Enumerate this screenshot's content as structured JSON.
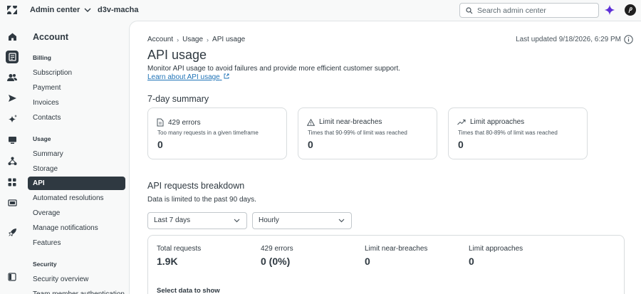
{
  "topbar": {
    "app_switcher_label": "Admin center",
    "subdomain": "d3v-macha",
    "search_placeholder": "Search admin center"
  },
  "nav": {
    "title": "Account",
    "sections": [
      {
        "label": "Billing",
        "items": [
          "Subscription",
          "Payment",
          "Invoices",
          "Contacts"
        ]
      },
      {
        "label": "Usage",
        "items": [
          "Summary",
          "Storage",
          "API",
          "Automated resolutions",
          "Overage",
          "Manage notifications",
          "Features"
        ]
      },
      {
        "label": "Security",
        "items": [
          "Security overview",
          "Team member authentication"
        ]
      }
    ],
    "active_item": "API"
  },
  "breadcrumb": [
    "Account",
    "API usage"
  ],
  "breadcrumb_usage": "Usage",
  "last_updated": "Last updated 9/18/2026, 6:29 PM",
  "page": {
    "title": "API usage",
    "description": "Monitor API usage to avoid failures and provide more efficient customer support.",
    "learn_link": "Learn about API usage"
  },
  "summary": {
    "title": "7-day summary",
    "cards": [
      {
        "icon": "document-icon",
        "title": "429 errors",
        "subtitle": "Too many requests in a given timeframe",
        "value": "0"
      },
      {
        "icon": "warning-icon",
        "title": "Limit near-breaches",
        "subtitle": "Times that 90-99% of limit was reached",
        "value": "0"
      },
      {
        "icon": "trend-up-icon",
        "title": "Limit approaches",
        "subtitle": "Times that 80-89% of limit was reached",
        "value": "0"
      }
    ]
  },
  "breakdown": {
    "title": "API requests breakdown",
    "note": "Data is limited to the past 90 days.",
    "range_select": "Last 7 days",
    "granularity_select": "Hourly",
    "stats": [
      {
        "label": "Total requests",
        "value": "1.9K"
      },
      {
        "label": "429 errors",
        "value": "0 (0%)"
      },
      {
        "label": "Limit near-breaches",
        "value": "0"
      },
      {
        "label": "Limit approaches",
        "value": "0"
      }
    ],
    "select_data_label": "Select data to show"
  },
  "colors": {
    "accent": "#2f3941",
    "link": "#1f73b7",
    "ai": "#5d2fd6"
  }
}
